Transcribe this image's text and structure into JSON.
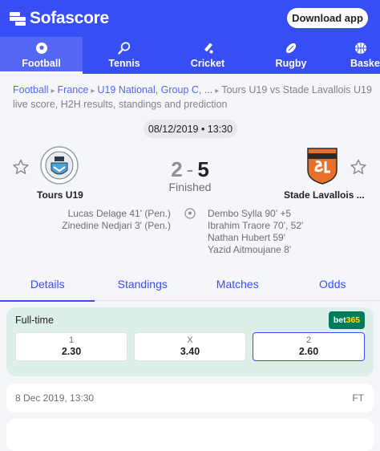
{
  "app": {
    "name": "Sofascore",
    "download_label": "Download app"
  },
  "sport_tabs": [
    {
      "label": "Football",
      "icon": "football-icon",
      "active": true
    },
    {
      "label": "Tennis",
      "icon": "tennis-icon",
      "active": false
    },
    {
      "label": "Cricket",
      "icon": "cricket-icon",
      "active": false
    },
    {
      "label": "Rugby",
      "icon": "rugby-icon",
      "active": false
    },
    {
      "label": "Basket",
      "icon": "basketball-icon",
      "active": false
    }
  ],
  "breadcrumb": {
    "items": [
      "Football",
      "France",
      "U19 National, Group C, ..."
    ],
    "current": "Tours U19 vs Stade Lavallois U19",
    "subtitle": "live score, H2H results, standings and prediction"
  },
  "match": {
    "datetime": "08/12/2019 • 13:30",
    "home": {
      "name": "Tours U19",
      "score": "2"
    },
    "away": {
      "name": "Stade Lavallois ...",
      "score": "5"
    },
    "score_separator": "-",
    "status": "Finished",
    "home_scorers": [
      "Lucas Delage 41' (Pen.)",
      "Zinedine Nedjari 3' (Pen.)"
    ],
    "away_scorers": [
      "Dembo Sylla 90' +5",
      "Ibrahim Traore 70', 52'",
      "Nathan Hubert 59'",
      "Yazid Aitmoujane 8'"
    ]
  },
  "detail_tabs": [
    "Details",
    "Standings",
    "Matches",
    "Odds"
  ],
  "odds": {
    "title": "Full-time",
    "provider": {
      "prefix": "bet",
      "suffix": "365"
    },
    "options": [
      {
        "label": "1",
        "value": "2.30"
      },
      {
        "label": "X",
        "value": "3.40"
      },
      {
        "label": "2",
        "value": "2.60"
      }
    ]
  },
  "info": {
    "date": "8 Dec 2019, 13:30",
    "status": "FT"
  },
  "colors": {
    "brand": "#374df5",
    "bet365_green": "#027b5b"
  }
}
